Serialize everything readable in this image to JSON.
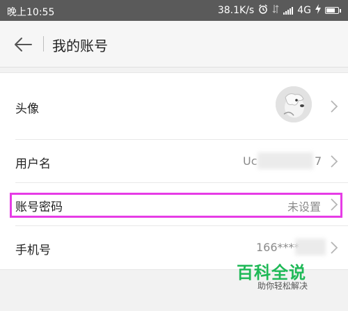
{
  "status_bar": {
    "time": "晚上10:55",
    "speed": "38.1K/s",
    "network": "4G"
  },
  "header": {
    "title": "我的账号"
  },
  "rows": [
    {
      "label": "头像",
      "value": ""
    },
    {
      "label": "用户名",
      "value_visible_start": "Uc",
      "value_visible_end": "7"
    },
    {
      "label": "账号密码",
      "value": "未设置"
    },
    {
      "label": "手机号",
      "value_visible_start": "166****"
    }
  ],
  "watermark": {
    "title": "百科全说",
    "subtitle": "助你轻松解决"
  },
  "colors": {
    "highlight": "#e63ce6",
    "watermark_green": "#1fb957",
    "status_bar_bg": "#5a5a5a"
  }
}
